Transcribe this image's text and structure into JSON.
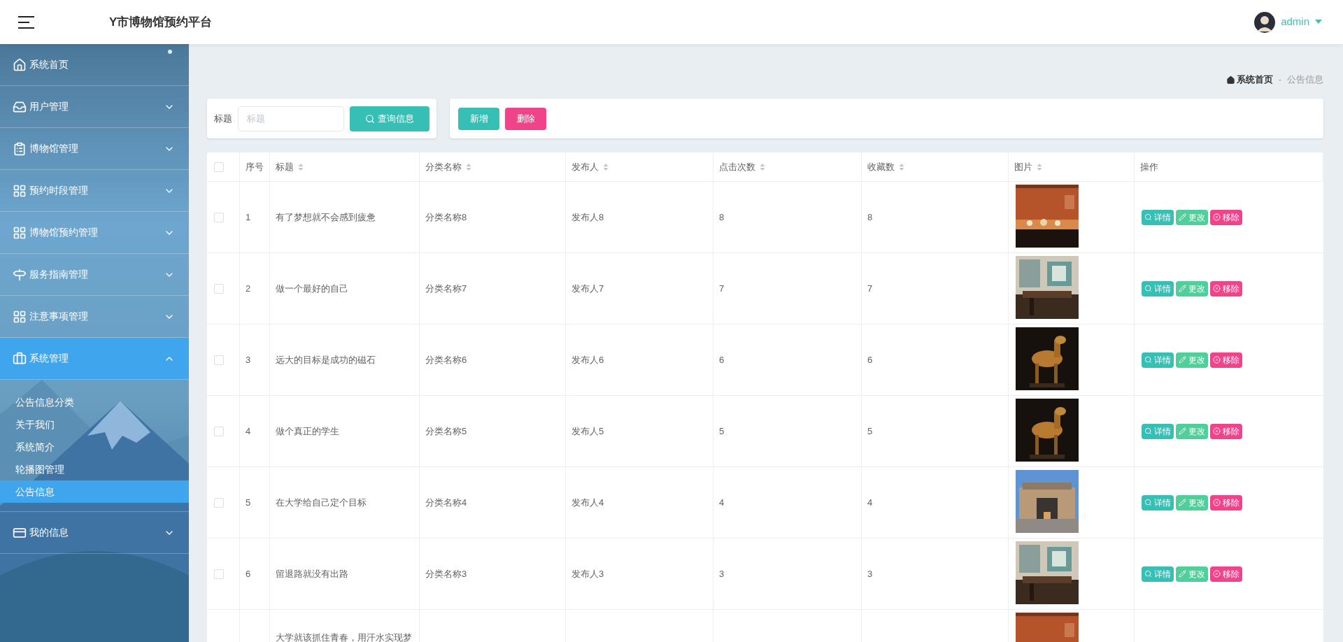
{
  "header": {
    "title": "Y市博物馆预约平台",
    "user": "admin"
  },
  "sidebar": {
    "items": [
      {
        "kind": "link",
        "label": "系统首页",
        "selected": false
      },
      {
        "kind": "menu",
        "label": "用户管理",
        "selected": false,
        "expanded": false
      },
      {
        "kind": "menu",
        "label": "博物馆管理",
        "selected": false,
        "expanded": false
      },
      {
        "kind": "menu",
        "label": "预约时段管理",
        "selected": false,
        "expanded": false
      },
      {
        "kind": "menu",
        "label": "博物馆预约管理",
        "selected": false,
        "expanded": false
      },
      {
        "kind": "menu",
        "label": "服务指南管理",
        "selected": false,
        "expanded": false
      },
      {
        "kind": "menu",
        "label": "注意事项管理",
        "selected": false,
        "expanded": false
      },
      {
        "kind": "menu",
        "label": "系统管理",
        "selected": true,
        "expanded": true,
        "children": [
          {
            "label": "公告信息分类",
            "selected": false
          },
          {
            "label": "关于我们",
            "selected": false
          },
          {
            "label": "系统简介",
            "selected": false
          },
          {
            "label": "轮播图管理",
            "selected": false
          },
          {
            "label": "公告信息",
            "selected": true
          }
        ]
      },
      {
        "kind": "menu",
        "label": "我的信息",
        "selected": false,
        "expanded": false
      }
    ]
  },
  "breadcrumb": [
    "系统首页",
    "-",
    "公告信息"
  ],
  "search": {
    "label": "标题",
    "placeholder": "标题",
    "button": "查询信息"
  },
  "toolbar": [
    {
      "kind": "add",
      "label": "新增"
    },
    {
      "kind": "delete",
      "label": "删除"
    }
  ],
  "table": {
    "select_all": {
      "checked": false
    },
    "columns": [
      {
        "label": "序号",
        "sortable": false
      },
      {
        "label": "标题",
        "sortable": true
      },
      {
        "label": "分类名称",
        "sortable": true
      },
      {
        "label": "发布人",
        "sortable": true
      },
      {
        "label": "点击次数",
        "sortable": true
      },
      {
        "label": "收藏数",
        "sortable": true
      },
      {
        "label": "图片",
        "sortable": true
      },
      {
        "label": "操作",
        "sortable": false
      }
    ],
    "rows": [
      {
        "checked": false,
        "cells": [
          "1",
          "有了梦想就不会感到疲惫",
          "分类名称8",
          "发布人8",
          "8",
          "8"
        ],
        "image": {
          "kind": "picture"
        },
        "actions": [
          {
            "kind": "detail",
            "label": "详情"
          },
          {
            "kind": "edit",
            "label": "更改"
          },
          {
            "kind": "remove",
            "label": "移除"
          }
        ]
      },
      {
        "checked": false,
        "cells": [
          "2",
          "做一个最好的自己",
          "分类名称7",
          "发布人7",
          "7",
          "7"
        ],
        "image": {
          "kind": "picture"
        },
        "actions": [
          {
            "kind": "detail",
            "label": "详情"
          },
          {
            "kind": "edit",
            "label": "更改"
          },
          {
            "kind": "remove",
            "label": "移除"
          }
        ]
      },
      {
        "checked": false,
        "cells": [
          "3",
          "远大的目标是成功的磁石",
          "分类名称6",
          "发布人6",
          "6",
          "6"
        ],
        "image": {
          "kind": "picture"
        },
        "actions": [
          {
            "kind": "detail",
            "label": "详情"
          },
          {
            "kind": "edit",
            "label": "更改"
          },
          {
            "kind": "remove",
            "label": "移除"
          }
        ]
      },
      {
        "checked": false,
        "cells": [
          "4",
          "做个真正的学生",
          "分类名称5",
          "发布人5",
          "5",
          "5"
        ],
        "image": {
          "kind": "picture"
        },
        "actions": [
          {
            "kind": "detail",
            "label": "详情"
          },
          {
            "kind": "edit",
            "label": "更改"
          },
          {
            "kind": "remove",
            "label": "移除"
          }
        ]
      },
      {
        "checked": false,
        "cells": [
          "5",
          "在大学给自己定个目标",
          "分类名称4",
          "发布人4",
          "4",
          "4"
        ],
        "image": {
          "kind": "picture"
        },
        "actions": [
          {
            "kind": "detail",
            "label": "详情"
          },
          {
            "kind": "edit",
            "label": "更改"
          },
          {
            "kind": "remove",
            "label": "移除"
          }
        ]
      },
      {
        "checked": false,
        "cells": [
          "6",
          "留退路就没有出路",
          "分类名称3",
          "发布人3",
          "3",
          "3"
        ],
        "image": {
          "kind": "picture"
        },
        "actions": [
          {
            "kind": "detail",
            "label": "详情"
          },
          {
            "kind": "edit",
            "label": "更改"
          },
          {
            "kind": "remove",
            "label": "移除"
          }
        ]
      },
      {
        "kind": "cut",
        "cells": [
          "",
          "大学就该抓住青春，用汗水实现梦"
        ],
        "image": {
          "kind": "picture"
        }
      }
    ]
  }
}
